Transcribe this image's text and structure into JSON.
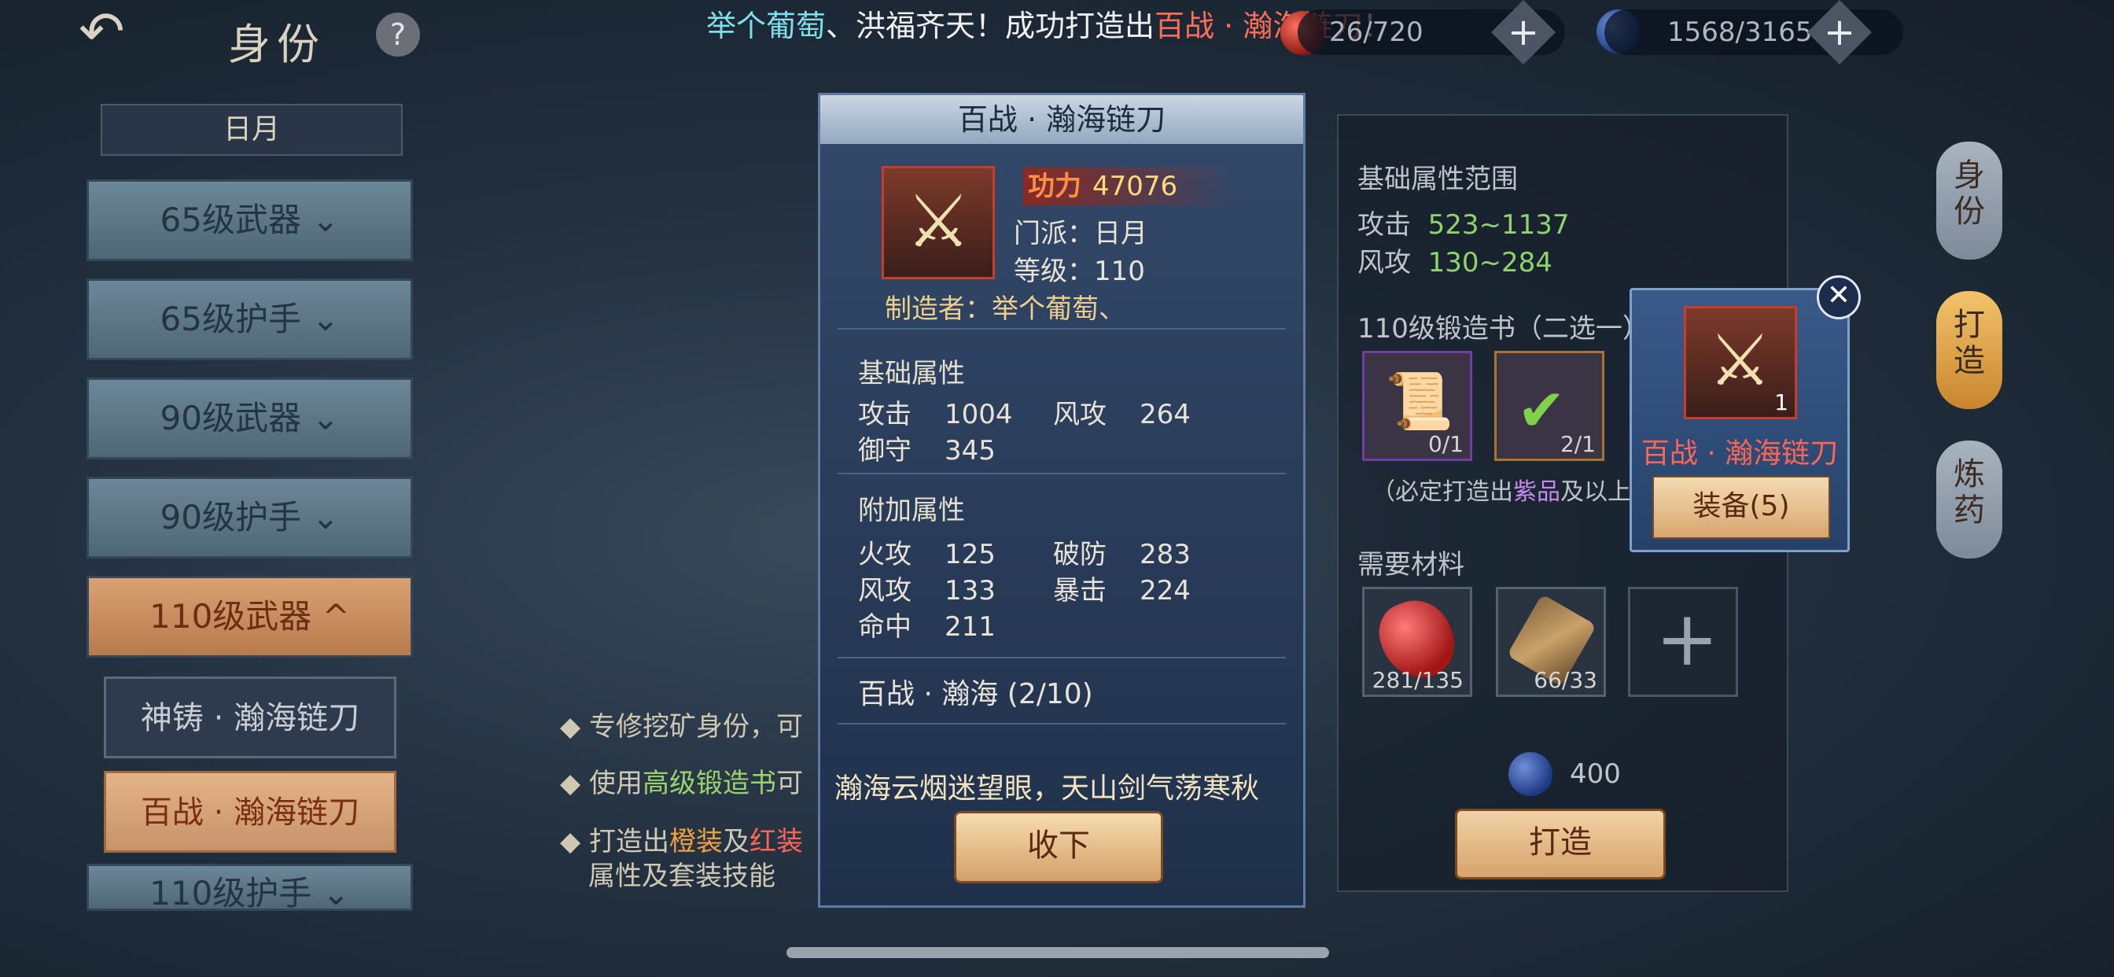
{
  "topbar": {
    "back_icon": "back-arrow-icon",
    "title": "身份",
    "help": "?",
    "announce_a": "举个葡萄",
    "announce_b": "、洪福齐天！成功打造出",
    "announce_c": "百战 · 瀚海链刀",
    "announce_d": "！",
    "resource1": "26/720",
    "resource2": "1568/3165",
    "plus": "+"
  },
  "sidebar": {
    "section": "日月",
    "categories": [
      "65级武器 ⌄",
      "65级护手 ⌄",
      "90级武器 ⌄",
      "90级护手 ⌄",
      "110级武器 ^"
    ],
    "items": [
      "神铸 · 瀚海链刀",
      "百战 · 瀚海链刀"
    ],
    "next_category": "110级护手 ⌄"
  },
  "center": {
    "bullet1": "专修挖矿身份，可",
    "bullet2_a": "使用",
    "bullet2_b": "高级锻造书",
    "bullet2_c": "可",
    "bullet3_a": "打造出",
    "bullet3_b": "橙装",
    "bullet3_c": "及",
    "bullet3_d": "红装",
    "bullet3_line2": "属性及套装技能"
  },
  "right_panel": {
    "range_title": "基础属性范围",
    "atk_label": "攻击",
    "atk_range": "523~1137",
    "wind_label": "风攻",
    "wind_range": "130~284",
    "book_title": "110级锻造书（二选一）",
    "book1_count": "0/1",
    "book2_count": "2/1",
    "note_a": "（必定打造出",
    "note_b": "紫品",
    "note_c": "及以上",
    "materials_title": "需要材料",
    "mat1_count": "281/135",
    "mat2_count": "66/33",
    "cost": "400",
    "forge_button": "打造"
  },
  "side_tabs": [
    "身份",
    "打造",
    "炼药"
  ],
  "modal": {
    "title": "百战 · 瀚海链刀",
    "power_label": "功力",
    "power_value": "47076",
    "school": "门派：日月",
    "level": "等级：110",
    "maker": "制造者：举个葡萄、",
    "base_title": "基础属性",
    "base_stats": [
      {
        "name": "攻击",
        "value": "1004"
      },
      {
        "name": "风攻",
        "value": "264"
      },
      {
        "name": "御守",
        "value": "345"
      }
    ],
    "extra_title": "附加属性",
    "extra_stats": [
      {
        "name": "火攻",
        "value": "125"
      },
      {
        "name": "破防",
        "value": "283"
      },
      {
        "name": "风攻",
        "value": "133"
      },
      {
        "name": "暴击",
        "value": "224"
      },
      {
        "name": "命中",
        "value": "211"
      }
    ],
    "set_name": "百战 · 瀚海 (2/10)",
    "poem": "瀚海云烟迷望眼，天山剑气荡寒秋",
    "accept_button": "收下"
  },
  "popup": {
    "item_count": "1",
    "name": "百战 · 瀚海链刀",
    "equip_button": "装备(5)",
    "close": "✕"
  }
}
